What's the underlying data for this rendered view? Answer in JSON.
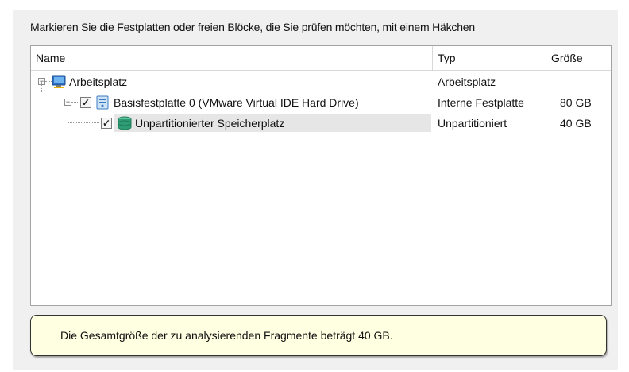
{
  "instruction": "Markieren Sie die Festplatten oder freien Blöcke, die Sie prüfen möchten, mit einem Häkchen",
  "columns": {
    "name": "Name",
    "type": "Typ",
    "size": "Größe"
  },
  "rows": [
    {
      "name": "Arbeitsplatz",
      "type": "Arbeitsplatz",
      "size": "",
      "icon": "computer-icon",
      "checked": false
    },
    {
      "name": "Basisfestplatte 0 (VMware Virtual IDE Hard Drive)",
      "type": "Interne Festplatte",
      "size": "80 GB",
      "icon": "hard-disk-icon",
      "checked": true
    },
    {
      "name": "Unpartitionierter Speicherplatz",
      "type": "Unpartitioniert",
      "size": "40 GB",
      "icon": "unallocated-space-icon",
      "checked": true
    }
  ],
  "info_text": "Die Gesamtgröße der zu analysierenden Fragmente beträgt 40 GB.",
  "colors": {
    "info_background": "#ffffe1",
    "list_border": "#a3a3a3",
    "panel_background": "#f0f0f0"
  }
}
